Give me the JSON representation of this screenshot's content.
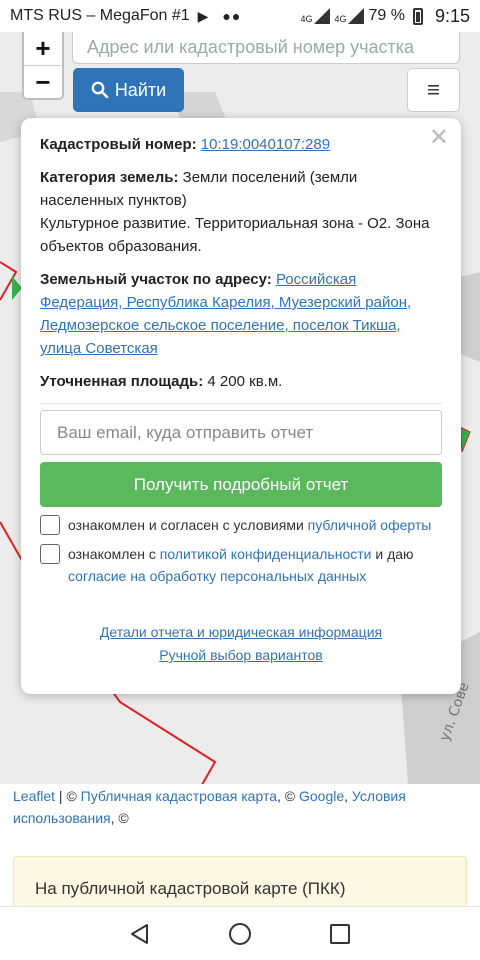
{
  "status_bar": {
    "carrier": "MTS RUS – MegaFon #1",
    "net1": "4G",
    "net2": "4G",
    "battery_percent": "79 %",
    "time": "9:15"
  },
  "map": {
    "zoom_in": "+",
    "zoom_out": "−",
    "search_placeholder": "Адрес или кадастровый номер участка",
    "find_label": "Найти",
    "menu_icon": "≡"
  },
  "popup": {
    "cadastral_label": "Кадастровый номер:",
    "cadastral_number": "10:19:0040107:289",
    "category_label": "Категория земель:",
    "category_value": "Земли поселений (земли населенных пунктов)",
    "zone_text": "Культурное развитие. Территориальная зона - О2. Зона объектов образования.",
    "address_label": "Земельный участок по адресу:",
    "address_value": "Российская Федерация, Республика Карелия, Муезерский район, Ледмозерское сельское поселение, поселок Тикша, улица Советская",
    "area_label": "Уточненная площадь:",
    "area_value": "4 200 кв.м.",
    "email_placeholder": "Ваш email, куда отправить отчет",
    "report_button": "Получить подробный отчет",
    "consent1_text": "ознакомлен и согласен с условиями",
    "consent1_link": "публичной оферты",
    "consent2_text1": "ознакомлен с",
    "consent2_link1": "политикой конфиденциальности",
    "consent2_text2": "и даю",
    "consent2_link2": "согласие на обработку персональных данных",
    "details_link": "Детали отчета и юридическая информация",
    "manual_link": "Ручной выбор вариантов"
  },
  "attribution": {
    "leaflet": "Leaflet",
    "sep1": " | © ",
    "pkk": "Публичная кадастровая карта",
    "sep2": ", © ",
    "google": "Google",
    "sep3": ", ",
    "terms": "Условия использования",
    "sep4": ", ©"
  },
  "note": {
    "text": "На публичной кадастровой карте (ПКК)"
  },
  "map_street_label": "ул. Сове"
}
